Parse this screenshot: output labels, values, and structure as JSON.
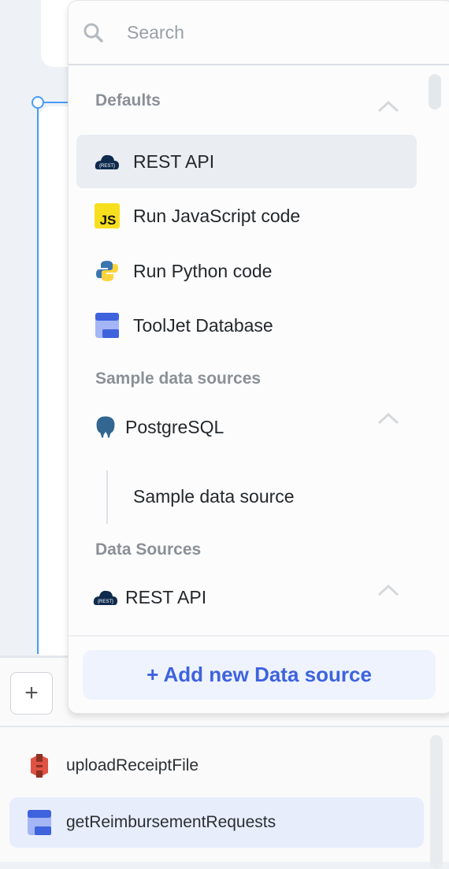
{
  "dropdown": {
    "search_placeholder": "Search",
    "sections": [
      {
        "title": "Defaults",
        "items": [
          {
            "label": "REST API",
            "icon": "rest-cloud-icon",
            "selected": true
          },
          {
            "label": "Run JavaScript code",
            "icon": "javascript-icon"
          },
          {
            "label": "Run Python code",
            "icon": "python-icon"
          },
          {
            "label": "ToolJet Database",
            "icon": "tooljet-database-icon"
          }
        ]
      },
      {
        "title": "Sample data sources",
        "items": [
          {
            "label": "PostgreSQL",
            "icon": "postgresql-icon",
            "children": [
              {
                "label": "Sample data source"
              }
            ]
          }
        ]
      },
      {
        "title": "Data Sources",
        "items": [
          {
            "label": "REST API",
            "icon": "rest-cloud-icon"
          }
        ]
      }
    ],
    "add_button": "+ Add new Data source"
  },
  "queries": [
    {
      "label": "uploadReceiptFile",
      "icon": "aws-s3-icon"
    },
    {
      "label": "getReimbursementRequests",
      "icon": "tooljet-database-icon",
      "selected": true
    }
  ],
  "colors": {
    "accent": "#3e63dd",
    "selection": "#e8edfc",
    "connector": "#4a9cf5"
  }
}
